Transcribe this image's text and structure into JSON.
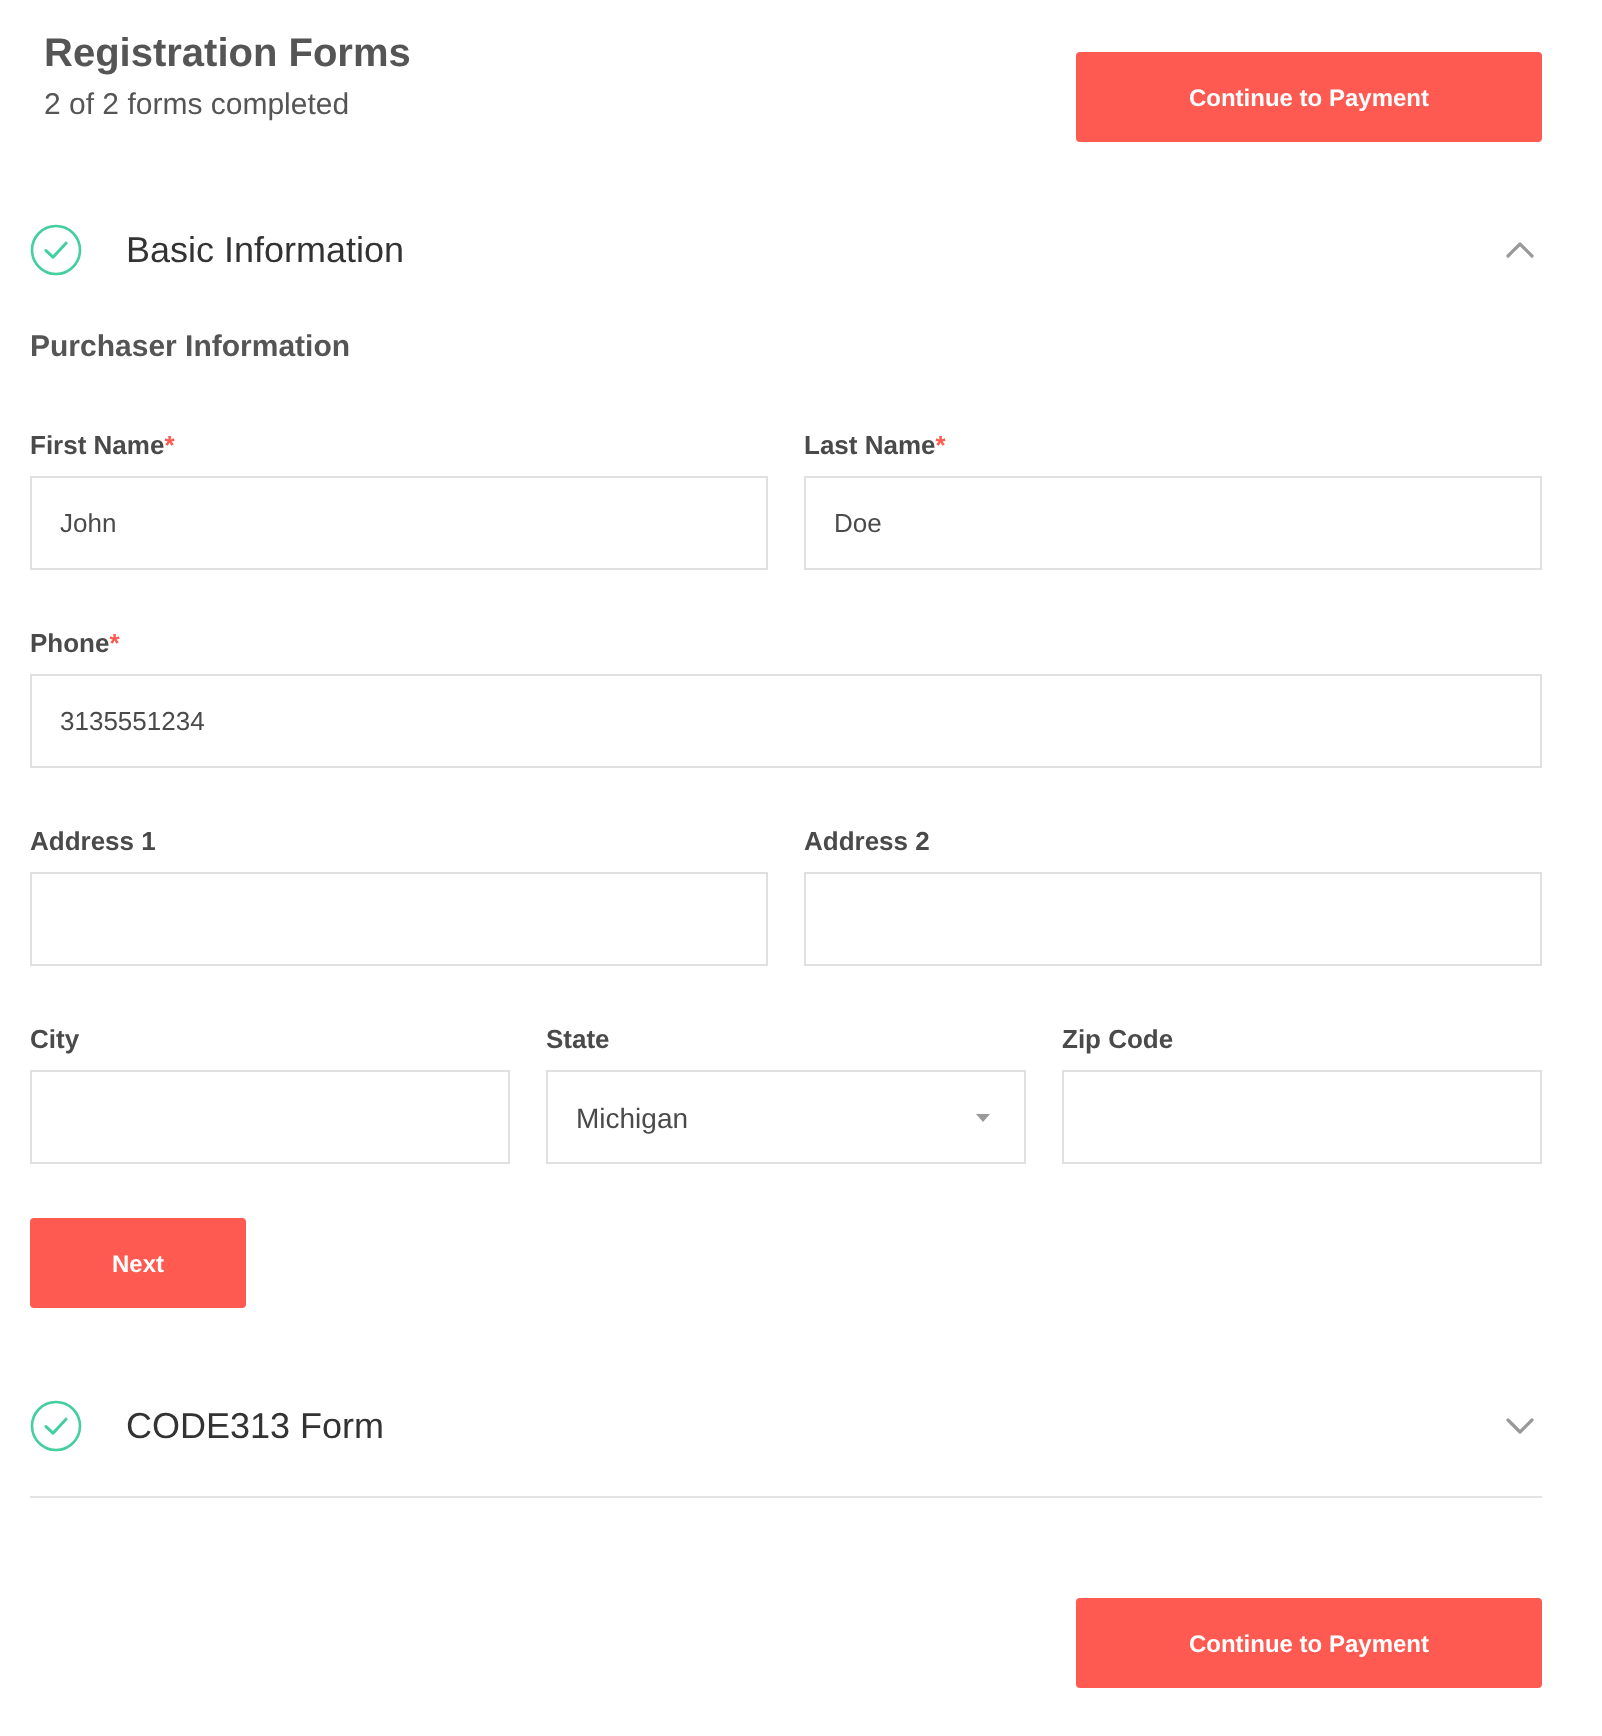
{
  "header": {
    "title": "Registration Forms",
    "progress": "2 of 2 forms completed",
    "continue_button": "Continue to Payment"
  },
  "sections": [
    {
      "title": "Basic Information",
      "completed": true,
      "expanded": true,
      "subsection": "Purchaser Information",
      "required_mark": "*",
      "field_rows": [
        [
          {
            "kind": "text",
            "label": "First Name",
            "required": true,
            "value": "John"
          },
          {
            "kind": "text",
            "label": "Last Name",
            "required": true,
            "value": "Doe"
          }
        ],
        [
          {
            "kind": "text",
            "label": "Phone",
            "required": true,
            "value": "3135551234"
          }
        ],
        [
          {
            "kind": "text",
            "label": "Address 1",
            "required": false
          },
          {
            "kind": "text",
            "label": "Address 2",
            "required": false
          }
        ],
        [
          {
            "kind": "text",
            "label": "City",
            "required": false
          },
          {
            "kind": "select",
            "label": "State",
            "required": false,
            "value": "Michigan"
          },
          {
            "kind": "text",
            "label": "Zip Code",
            "required": false
          }
        ]
      ],
      "next_button": "Next"
    },
    {
      "title": "CODE313 Form",
      "completed": true,
      "expanded": false
    }
  ],
  "footer": {
    "continue_button": "Continue to Payment"
  }
}
